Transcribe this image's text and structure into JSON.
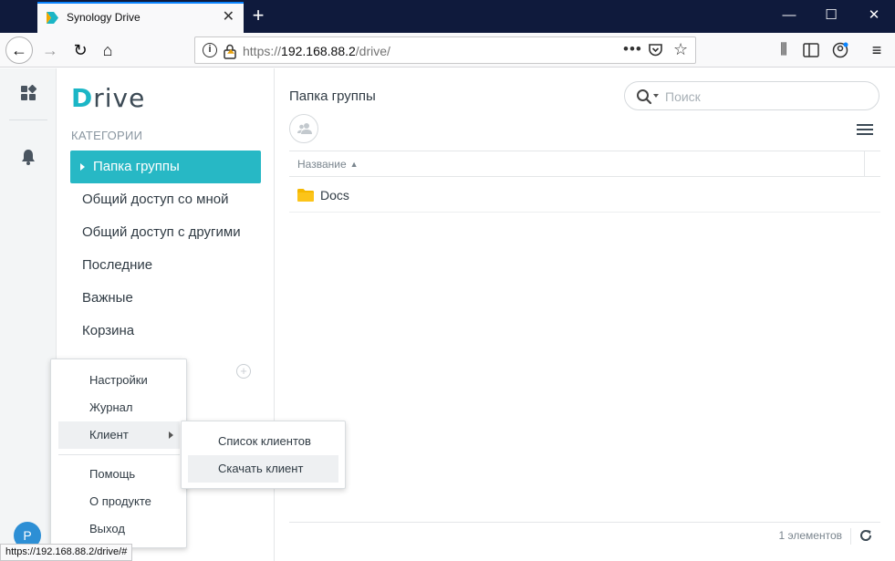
{
  "browser": {
    "tab_title": "Synology Drive",
    "url_scheme": "https://",
    "url_host": "192.168.88.2",
    "url_path": "/drive/",
    "status_link": "https://192.168.88.2/drive/#"
  },
  "sidebar": {
    "categories_heading": "КАТЕГОРИИ",
    "items": [
      {
        "label": "Папка группы",
        "active": true
      },
      {
        "label": "Общий доступ со мной"
      },
      {
        "label": "Общий доступ с другими"
      },
      {
        "label": "Последние"
      },
      {
        "label": "Важные"
      },
      {
        "label": "Корзина"
      }
    ],
    "avatar_initial": "P"
  },
  "main": {
    "title": "Папка группы",
    "search_placeholder": "Поиск",
    "column_name": "Название",
    "rows": [
      {
        "name": "Docs",
        "icon": "folder-icon"
      }
    ],
    "footer_count": "1 элементов"
  },
  "user_menu": {
    "items": [
      "Настройки",
      "Журнал",
      "Клиент",
      "Помощь",
      "О продукте",
      "Выход"
    ],
    "client_submenu": [
      "Список клиентов",
      "Скачать клиент"
    ]
  },
  "colors": {
    "accent": "#27b8c5",
    "titlebar": "#0f1a3c",
    "avatar": "#2d8fd5",
    "folder": "#f5b800"
  }
}
